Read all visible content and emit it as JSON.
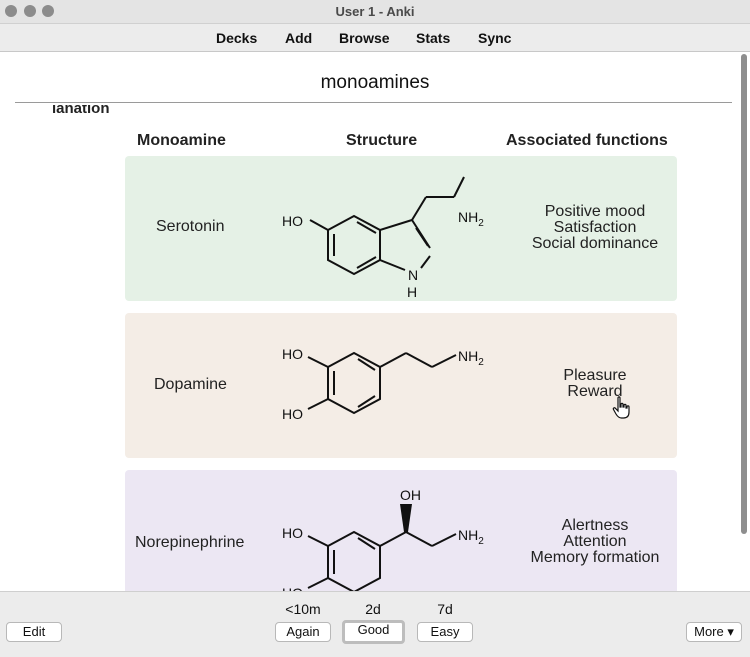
{
  "window": {
    "title": "User 1 - Anki"
  },
  "toolbar": {
    "decks": "Decks",
    "add": "Add",
    "browse": "Browse",
    "stats": "Stats",
    "sync": "Sync"
  },
  "card": {
    "question": "monoamines",
    "partial_heading": "lanation",
    "table": {
      "headers": {
        "monoamine": "Monoamine",
        "structure": "Structure",
        "functions": "Associated functions"
      },
      "rows": [
        {
          "name": "Serotonin",
          "functions": [
            "Positive mood",
            "Satisfaction",
            "Social dominance"
          ],
          "color": "#e5f1e6"
        },
        {
          "name": "Dopamine",
          "functions": [
            "Pleasure",
            "Reward"
          ],
          "color": "#f4ede6"
        },
        {
          "name": "Norepinephrine",
          "functions": [
            "Alertness",
            "Attention",
            "Memory formation"
          ],
          "color": "#ece7f3"
        }
      ]
    },
    "structure_labels": {
      "ho": "HO",
      "oh": "OH",
      "nh": "NH",
      "sub2": "2",
      "h": "H",
      "n": "N"
    }
  },
  "bottom": {
    "edit": "Edit",
    "more": "More ▾",
    "answers": [
      {
        "interval": "<10m",
        "label": "Again"
      },
      {
        "interval": "2d",
        "label": "Good"
      },
      {
        "interval": "7d",
        "label": "Easy"
      }
    ]
  },
  "icons": {
    "cursor": "hand-pointer-icon"
  }
}
